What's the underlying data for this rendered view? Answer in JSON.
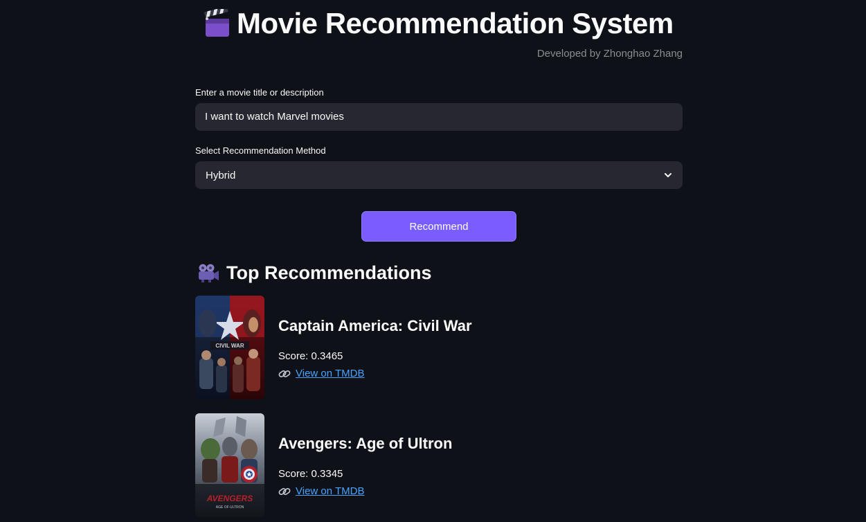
{
  "header": {
    "title": "Movie Recommendation System",
    "credit": "Developed by Zhonghao Zhang"
  },
  "query": {
    "label": "Enter a movie title or description",
    "value": "I want to watch Marvel movies"
  },
  "method": {
    "label": "Select Recommendation Method",
    "selected": "Hybrid"
  },
  "actions": {
    "recommend_label": "Recommend"
  },
  "results": {
    "heading": "Top Recommendations",
    "movies": [
      {
        "title": "Captain America: Civil War",
        "score": "Score: 0.3465",
        "link_text": "View on TMDB",
        "poster_text": "CIVIL WAR"
      },
      {
        "title": "Avengers: Age of Ultron",
        "score": "Score: 0.3345",
        "link_text": "View on TMDB",
        "poster_text": "AVENGERS",
        "poster_subtext": "AGE OF ULTRON"
      }
    ]
  },
  "colors": {
    "background": "#0e1117",
    "input_background": "#262730",
    "accent": "#7a5cff",
    "link": "#4aa3ff",
    "muted": "#8b8d93"
  },
  "icons": [
    "clapperboard-icon",
    "movie-camera-icon",
    "link-icon",
    "chevron-down-icon"
  ]
}
